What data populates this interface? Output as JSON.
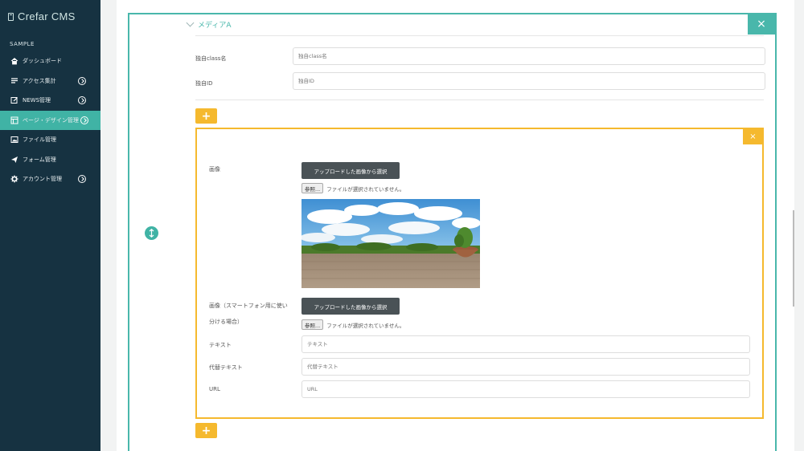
{
  "app": {
    "logo_text": "Crefar CMS",
    "section_label": "SAMPLE"
  },
  "sidebar": {
    "items": [
      {
        "label": "ダッシュボード",
        "icon": "home-icon",
        "expandable": false,
        "active": false
      },
      {
        "label": "アクセス集計",
        "icon": "list-icon",
        "expandable": true,
        "active": false
      },
      {
        "label": "NEWS管理",
        "icon": "edit-icon",
        "expandable": true,
        "active": false
      },
      {
        "label": "ページ・デザイン管理",
        "icon": "layout-icon",
        "expandable": true,
        "active": true
      },
      {
        "label": "ファイル管理",
        "icon": "image-icon",
        "expandable": false,
        "active": false
      },
      {
        "label": "フォーム管理",
        "icon": "send-icon",
        "expandable": false,
        "active": false
      },
      {
        "label": "アカウント管理",
        "icon": "gear-icon",
        "expandable": true,
        "active": false
      }
    ]
  },
  "media": {
    "title": "メディアA",
    "close_label": "×",
    "class_label": "独自class名",
    "class_placeholder": "独自class名",
    "id_label": "独自ID",
    "id_placeholder": "独自ID",
    "add_label": "+"
  },
  "image_block": {
    "close_label": "×",
    "image_label": "画像",
    "select_uploaded": "アップロードした画像から選択",
    "browse_label": "参照...",
    "no_file_text": "ファイルが選択されていません。",
    "sp_image_label_1": "画像（スマートフォン用に使い",
    "sp_image_label_2": "分ける場合）",
    "text_label": "テキスト",
    "text_placeholder": "テキスト",
    "alt_label": "代替テキスト",
    "alt_placeholder": "代替テキスト",
    "url_label": "URL",
    "url_placeholder": "URL",
    "add_label": "+"
  },
  "colors": {
    "sidebar_bg": "#163241",
    "accent_teal": "#40b3a5",
    "accent_yellow": "#f5b92e",
    "dark_button": "#4a5256"
  }
}
